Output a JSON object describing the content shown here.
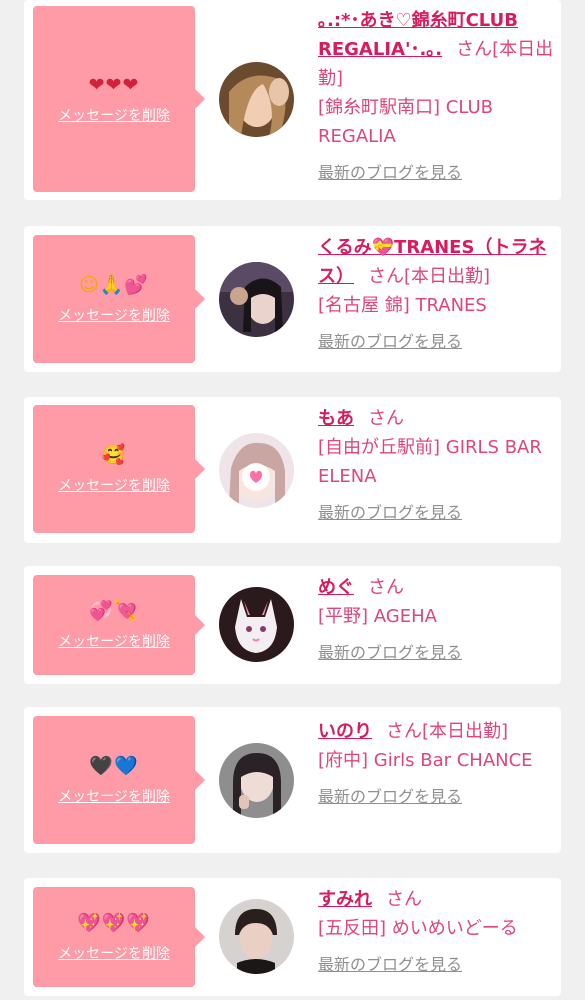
{
  "items": [
    {
      "emoji": "❤❤❤",
      "delete_label": "メッセージを削除",
      "name": "｡.:*･あき♡錦糸町CLUB REGALIA'･.｡.",
      "san": "さん",
      "status": "[本日出勤]",
      "shop": "[錦糸町駅南口] CLUB REGALIA",
      "blog_label": "最新のブログを見る"
    },
    {
      "emoji": "☺🙏💕",
      "delete_label": "メッセージを削除",
      "name": "くるみ💝TRANES（トラネス）",
      "san": "さん",
      "status": "[本日出勤]",
      "shop": "[名古屋 錦] TRANES",
      "blog_label": "最新のブログを見る"
    },
    {
      "emoji": "🥰",
      "delete_label": "メッセージを削除",
      "name": "もあ",
      "san": "さん",
      "status": "",
      "shop": "[自由が丘駅前] GIRLS BAR ELENA",
      "blog_label": "最新のブログを見る"
    },
    {
      "emoji": "💞💘",
      "delete_label": "メッセージを削除",
      "name": "めぐ",
      "san": "さん",
      "status": "",
      "shop": "[平野] AGEHA",
      "blog_label": "最新のブログを見る"
    },
    {
      "emoji": "🖤💙",
      "delete_label": "メッセージを削除",
      "name": "いのり",
      "san": "さん",
      "status": "[本日出勤]",
      "shop": "[府中] Girls Bar CHANCE",
      "blog_label": "最新のブログを見る"
    },
    {
      "emoji": "💖💖💖",
      "delete_label": "メッセージを削除",
      "name": "すみれ",
      "san": "さん",
      "status": "",
      "shop": "[五反田] めいめいどーる",
      "blog_label": "最新のブログを見る"
    }
  ],
  "colors": {
    "bubble": "#ff9aa7",
    "name": "#d81b5e",
    "text": "#e0457a",
    "link_gray": "#8f8f8f",
    "background": "#f0f0f0"
  }
}
